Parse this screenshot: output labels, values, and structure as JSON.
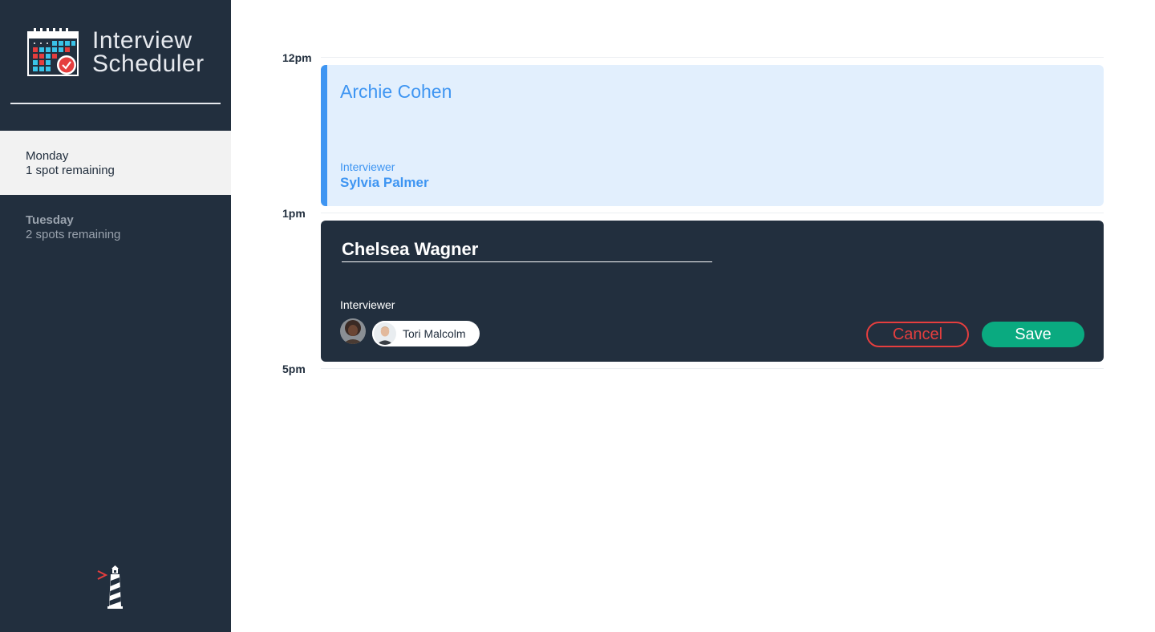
{
  "brand": {
    "title_line1": "Interview",
    "title_line2": "Scheduler"
  },
  "sidebar": {
    "days": [
      {
        "name": "Monday",
        "spots": "1 spot remaining",
        "selected": true
      },
      {
        "name": "Tuesday",
        "spots": "2 spots remaining",
        "selected": false
      }
    ]
  },
  "schedule": {
    "times": [
      "12pm",
      "1pm",
      "5pm"
    ],
    "booked": {
      "student": "Archie Cohen",
      "interviewer_label": "Interviewer",
      "interviewer": "Sylvia Palmer"
    },
    "form": {
      "student_value": "Chelsea Wagner",
      "interviewer_label": "Interviewer",
      "selected_interviewer": "Tori Malcolm",
      "cancel_label": "Cancel",
      "save_label": "Save"
    }
  },
  "colors": {
    "sidebar_bg": "#222f3e",
    "accent_blue": "#3e95f2",
    "booked_bg": "#e2effd",
    "cancel_red": "#e53e3e",
    "save_green": "#0aaa80"
  },
  "icons": [
    "calendar-check-icon",
    "lighthouse-logo-icon"
  ]
}
